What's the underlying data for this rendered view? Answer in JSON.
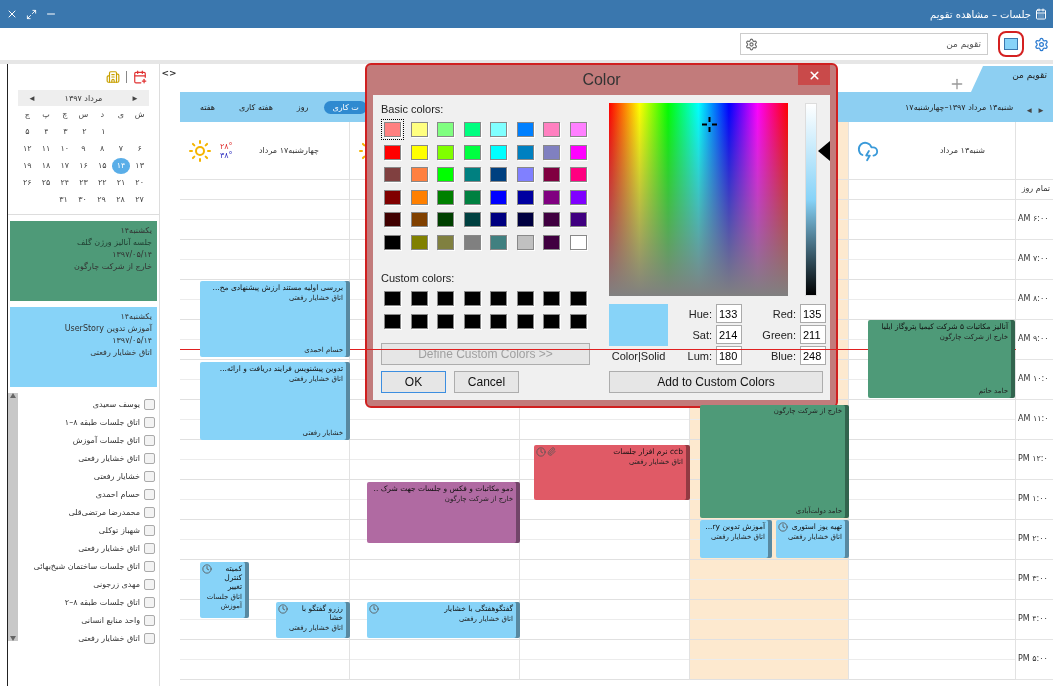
{
  "window": {
    "title": "جلسات – مشاهده تقویم"
  },
  "toolbar": {
    "search": {
      "placeholder": "تقویم من"
    }
  },
  "sidebar": {
    "mini_calendar": {
      "prev": "◄",
      "month": "مرداد ۱۳۹۷",
      "next": "►",
      "weekdays": [
        "ش",
        "ی",
        "د",
        "س",
        "چ",
        "پ",
        "ج"
      ],
      "weeks": [
        [
          {
            "label": "۱",
            "selected": false
          },
          {
            "label": "۲",
            "selected": false
          },
          {
            "label": "۳",
            "selected": false
          },
          {
            "label": "۴",
            "selected": false
          },
          {
            "label": "۵",
            "selected": false
          }
        ],
        [
          {
            "label": "۶",
            "selected": false
          },
          {
            "label": "۷",
            "selected": false
          },
          {
            "label": "۸",
            "selected": false
          },
          {
            "label": "۹",
            "selected": false
          },
          {
            "label": "۱۰",
            "selected": false
          },
          {
            "label": "۱۱",
            "selected": false
          },
          {
            "label": "۱۲",
            "selected": false
          }
        ],
        [
          {
            "label": "۱۳",
            "selected": false
          },
          {
            "label": "۱۴",
            "selected": true
          },
          {
            "label": "۱۵",
            "selected": false
          },
          {
            "label": "۱۶",
            "selected": false
          },
          {
            "label": "۱۷",
            "selected": false
          },
          {
            "label": "۱۸",
            "selected": false
          },
          {
            "label": "۱۹",
            "selected": false
          }
        ],
        [
          {
            "label": "۲۰",
            "selected": false
          },
          {
            "label": "۲۱",
            "selected": false
          },
          {
            "label": "۲۲",
            "selected": false
          },
          {
            "label": "۲۳",
            "selected": false
          },
          {
            "label": "۲۴",
            "selected": false
          },
          {
            "label": "۲۵",
            "selected": false
          },
          {
            "label": "۲۶",
            "selected": false
          }
        ],
        [
          {
            "label": "۲۷",
            "selected": false
          },
          {
            "label": "۲۸",
            "selected": false
          },
          {
            "label": "۲۹",
            "selected": false
          },
          {
            "label": "۳۰",
            "selected": false
          },
          {
            "label": "۳۱",
            "selected": false
          }
        ]
      ]
    },
    "agenda": [
      {
        "day": "یکشنبه۱۴",
        "title": "جلسه آنالیز ورژن گلف",
        "date": "۱۳۹۷/۰۵/۱۴",
        "location": "خارج از شرکت چارگون",
        "color": "#4e9a78"
      },
      {
        "day": "یکشنبه۱۴",
        "title": "آموزش تدوین UserStory",
        "date": "۱۳۹۷/۰۵/۱۴",
        "location": "اتاق خشایار رفعتی",
        "color": "#87d3f8"
      }
    ],
    "resources": [
      {
        "label": "یوسف سعیدی",
        "checked": false
      },
      {
        "label": "اتاق جلسات طبقه ۸–۱",
        "checked": false
      },
      {
        "label": "اتاق جلسات آموزش",
        "checked": false
      },
      {
        "label": "اتاق خشایار رفعتی",
        "checked": false
      },
      {
        "label": "خشایار رفعتی",
        "checked": false
      },
      {
        "label": "حسام احمدی",
        "checked": false
      },
      {
        "label": "محمدرضا مرتضی‌قلی",
        "checked": false
      },
      {
        "label": "شهباز توکلی",
        "checked": false
      },
      {
        "label": "اتاق خشایار رفعتی",
        "checked": false
      },
      {
        "label": "اتاق جلسات ساختمان شیخ‌بهائی",
        "checked": false
      },
      {
        "label": "مهدی زرجونی",
        "checked": false
      },
      {
        "label": "اتاق جلسات طبقه ۸–۲",
        "checked": false
      },
      {
        "label": "واحد منابع انسانی",
        "checked": false
      },
      {
        "label": "اتاق خشایار رفعتی",
        "checked": false
      }
    ]
  },
  "calendar": {
    "collapse_toggle": "<>",
    "tabs": [
      {
        "label": "تقویم من",
        "selected": true
      }
    ],
    "views": [
      {
        "label": "ت کاری",
        "selected": true
      },
      {
        "label": "روز",
        "selected": false
      },
      {
        "label": "هفته کاری",
        "selected": false
      },
      {
        "label": "هفته",
        "selected": false
      }
    ],
    "range": "شنبه۱۳ مرداد ۱۳۹۷–چهارشنبه۱۷",
    "nav": {
      "prev": "◄",
      "next": "►"
    },
    "all_day_label": "تمام روز",
    "time_slots": [
      "AM ۶:۰۰",
      "AM ۷:۰۰",
      "AM ۸:۰۰",
      "AM ۹:۰۰",
      "AM ۱۰:۰",
      "AM ۱۱:۰",
      "PM ۱۲:۰",
      "PM ۱:۰۰",
      "PM ۲:۰۰",
      "PM ۳:۰۰",
      "PM ۴:۰۰",
      "PM ۵:۰۰"
    ],
    "days": [
      {
        "label": "شنبه۱۳ مرداد",
        "forecast": {
          "kind": "cloud"
        },
        "today": false,
        "events": [
          {
            "title": "آنالیز مکاتبات ۵ شرکت کیمیا پتروگاز ایلیا",
            "location": "خارج از شرکت چارگون",
            "person": "حامد حاتم",
            "color": "#4e9a78",
            "reminder": false,
            "attachment": false
          }
        ]
      },
      {
        "today": true,
        "events": [
          {
            "location": "خارج از شرکت چارگون",
            "person": "حامد دولت‌آبادی",
            "color": "#4e9a78",
            "reminder": false,
            "attachment": false
          },
          {
            "title": "تهیه یوز استوری",
            "location": "اتاق خشایار رفعتی",
            "color": "#87d3f8",
            "reminder": true,
            "attachment": false
          },
          {
            "title": "آموزش تدوین ry...",
            "location": "اتاق خشایار رفعتی",
            "color": "#87d3f8",
            "reminder": false,
            "attachment": false
          }
        ]
      },
      {
        "today": false,
        "events": [
          {
            "title": "ccb نرم افزار جلسات",
            "location": "اتاق خشایار رفعتی",
            "color": "#e05a66",
            "reminder": true,
            "attachment": true
          }
        ]
      },
      {
        "forecast": {
          "kind": "sun"
        },
        "today": false,
        "events": [
          {
            "title": "دمو مکاتبات و فکس و جلسات جهت شرک ..",
            "location": "خارج از شرکت چارگون",
            "color": "#b06aa2",
            "reminder": false,
            "attachment": false
          },
          {
            "title": "گفتگوهفتگی با خشایار",
            "location": "اتاق خشایار رفعتی",
            "color": "#87d3f8",
            "reminder": true,
            "attachment": false
          }
        ]
      },
      {
        "label": "چهارشنبه۱۷ مرداد",
        "forecast": {
          "kind": "sun"
        },
        "temperature_1": "۲۸°",
        "temperature_2": "۳۸°",
        "today": false,
        "events": [
          {
            "title": "بررسی اولیه مستند ارزش پیشنهادی مح...",
            "location": "اتاق خشایار رفعتی",
            "person": "حسام احمدی",
            "color": "#87d3f8",
            "reminder": false,
            "attachment": false
          },
          {
            "title": "تدوین پیشنویس فرایند دریافت و ارائه...",
            "location": "اتاق خشایار رفعتی",
            "person": "خشایار رفعتی",
            "color": "#87d3f8",
            "reminder": false,
            "attachment": false
          },
          {
            "title": "کمیته کنترل تغییر",
            "location": "اتاق جلسات آموزش",
            "color": "#87d3f8",
            "reminder": true,
            "attachment": false
          },
          {
            "title": "رزرو گفتگو با خشا",
            "location": "اتاق خشایار رفعتی",
            "color": "#87d3f8",
            "reminder": true,
            "attachment": false
          }
        ]
      }
    ]
  },
  "color_dialog": {
    "title": "Color",
    "basic_label": "Basic colors:",
    "basic_colors": [
      {
        "color": "#ff8080",
        "selected": true
      },
      {
        "color": "#ffff80",
        "selected": false
      },
      {
        "color": "#80ff80",
        "selected": false
      },
      {
        "color": "#00ff80",
        "selected": false
      },
      {
        "color": "#80ffff",
        "selected": false
      },
      {
        "color": "#0080ff",
        "selected": false
      },
      {
        "color": "#ff80c0",
        "selected": false
      },
      {
        "color": "#ff80ff",
        "selected": false
      },
      {
        "color": "#ff0000",
        "selected": false
      },
      {
        "color": "#ffff00",
        "selected": false
      },
      {
        "color": "#80ff00",
        "selected": false
      },
      {
        "color": "#00ff40",
        "selected": false
      },
      {
        "color": "#00ffff",
        "selected": false
      },
      {
        "color": "#0080c0",
        "selected": false
      },
      {
        "color": "#8080c0",
        "selected": false
      },
      {
        "color": "#ff00ff",
        "selected": false
      },
      {
        "color": "#804040",
        "selected": false
      },
      {
        "color": "#ff8040",
        "selected": false
      },
      {
        "color": "#00ff00",
        "selected": false
      },
      {
        "color": "#008080",
        "selected": false
      },
      {
        "color": "#004080",
        "selected": false
      },
      {
        "color": "#8080ff",
        "selected": false
      },
      {
        "color": "#800040",
        "selected": false
      },
      {
        "color": "#ff0080",
        "selected": false
      },
      {
        "color": "#800000",
        "selected": false
      },
      {
        "color": "#ff8000",
        "selected": false
      },
      {
        "color": "#008000",
        "selected": false
      },
      {
        "color": "#008040",
        "selected": false
      },
      {
        "color": "#0000ff",
        "selected": false
      },
      {
        "color": "#0000a0",
        "selected": false
      },
      {
        "color": "#800080",
        "selected": false
      },
      {
        "color": "#8000ff",
        "selected": false
      },
      {
        "color": "#400000",
        "selected": false
      },
      {
        "color": "#804000",
        "selected": false
      },
      {
        "color": "#004000",
        "selected": false
      },
      {
        "color": "#004040",
        "selected": false
      },
      {
        "color": "#000080",
        "selected": false
      },
      {
        "color": "#000040",
        "selected": false
      },
      {
        "color": "#400040",
        "selected": false
      },
      {
        "color": "#400080",
        "selected": false
      },
      {
        "color": "#000000",
        "selected": false
      },
      {
        "color": "#808000",
        "selected": false
      },
      {
        "color": "#808040",
        "selected": false
      },
      {
        "color": "#808080",
        "selected": false
      },
      {
        "color": "#408080",
        "selected": false
      },
      {
        "color": "#c0c0c0",
        "selected": false
      },
      {
        "color": "#400040",
        "selected": false
      },
      {
        "color": "#ffffff",
        "selected": false
      }
    ],
    "custom_label": "Custom colors:",
    "custom_colors": [
      {
        "color": "#000000"
      },
      {
        "color": "#000000"
      },
      {
        "color": "#000000"
      },
      {
        "color": "#000000"
      },
      {
        "color": "#000000"
      },
      {
        "color": "#000000"
      },
      {
        "color": "#000000"
      },
      {
        "color": "#000000"
      },
      {
        "color": "#000000"
      },
      {
        "color": "#000000"
      },
      {
        "color": "#000000"
      },
      {
        "color": "#000000"
      },
      {
        "color": "#000000"
      },
      {
        "color": "#000000"
      },
      {
        "color": "#000000"
      },
      {
        "color": "#000000"
      }
    ],
    "define_button": {
      "label": "Define Custom Colors >>",
      "disabled": true
    },
    "ok": "OK",
    "cancel": "Cancel",
    "preview": {
      "color": "#87d3f8",
      "label": "Color|Solid"
    },
    "hsl": [
      {
        "label": "Hue:",
        "value": "133"
      },
      {
        "label": "Sat:",
        "value": "214"
      },
      {
        "label": "Lum:",
        "value": "180"
      }
    ],
    "rgb": [
      {
        "label": "Red:",
        "value": "135"
      },
      {
        "label": "Green:",
        "value": "211"
      },
      {
        "label": "Blue:",
        "value": "248"
      }
    ],
    "add_button": "Add to Custom Colors"
  }
}
